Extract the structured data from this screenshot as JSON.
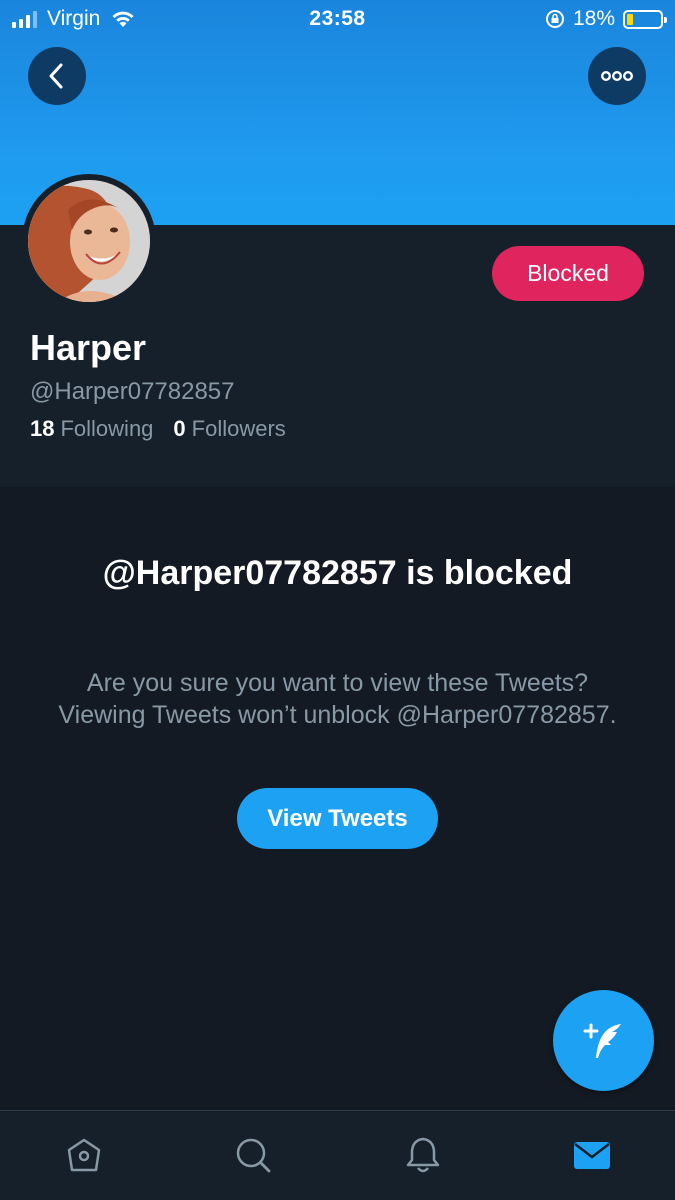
{
  "status_bar": {
    "carrier": "Virgin",
    "time": "23:58",
    "battery_percent": "18%",
    "battery_level": 0.18
  },
  "profile": {
    "name": "Harper",
    "handle": "@Harper07782857",
    "following_count": "18",
    "following_label": "Following",
    "followers_count": "0",
    "followers_label": "Followers",
    "blocked_button_label": "Blocked"
  },
  "blocked_notice": {
    "title": "@Harper07782857 is blocked",
    "description": "Are you sure you want to view these Tweets? Viewing Tweets won’t unblock @Harper07782857.",
    "view_button_label": "View Tweets"
  },
  "tabbar": {
    "items": [
      "home-icon",
      "search-icon",
      "notifications-icon",
      "messages-icon"
    ],
    "active": "messages-icon"
  },
  "colors": {
    "banner": "#1da1f2",
    "blocked": "#e0245e",
    "accent": "#1da1f2",
    "background": "#141a23",
    "header_background": "#16202b",
    "secondary_text": "#8899a6"
  }
}
